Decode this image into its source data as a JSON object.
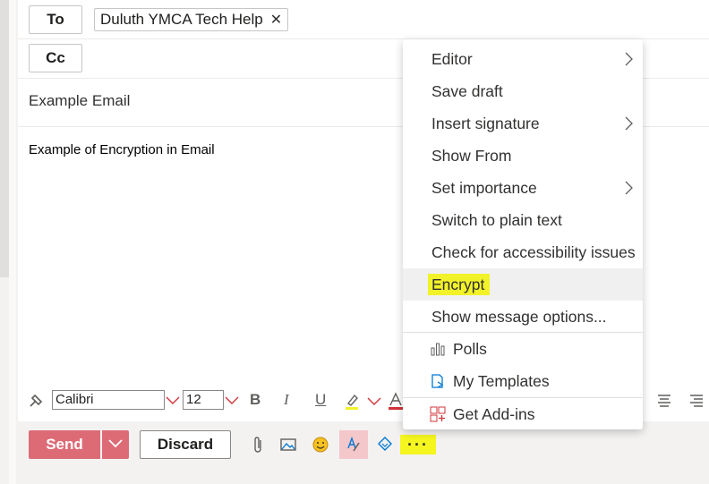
{
  "recipients": {
    "to_label": "To",
    "cc_label": "Cc",
    "to_chip": "Duluth YMCA Tech Help",
    "chip_remove": "✕"
  },
  "subject": "Example Email",
  "body_text": "Example of Encryption in Email",
  "format_bar": {
    "font_name": "Calibri",
    "font_size": "12",
    "bold": "B",
    "italic": "I",
    "underline": "U"
  },
  "actions": {
    "send_label": "Send",
    "discard_label": "Discard",
    "more_label": "···"
  },
  "menu": {
    "items": [
      {
        "label": "Editor",
        "submenu": true
      },
      {
        "label": "Save draft",
        "submenu": false
      },
      {
        "label": "Insert signature",
        "submenu": true
      },
      {
        "label": "Show From",
        "submenu": false
      },
      {
        "label": "Set importance",
        "submenu": true
      },
      {
        "label": "Switch to plain text",
        "submenu": false
      },
      {
        "label": "Check for accessibility issues",
        "submenu": false
      },
      {
        "label": "Encrypt",
        "submenu": false,
        "highlighted": true
      },
      {
        "label": "Show message options...",
        "submenu": false
      }
    ],
    "addins": [
      {
        "label": "Polls",
        "icon": "polls-icon"
      },
      {
        "label": "My Templates",
        "icon": "templates-icon"
      },
      {
        "label": "Get Add-ins",
        "icon": "add-ins-icon"
      }
    ]
  },
  "colors": {
    "send": "#dc6b76",
    "highlight": "#f2f229",
    "accent_blue": "#0078d4"
  }
}
